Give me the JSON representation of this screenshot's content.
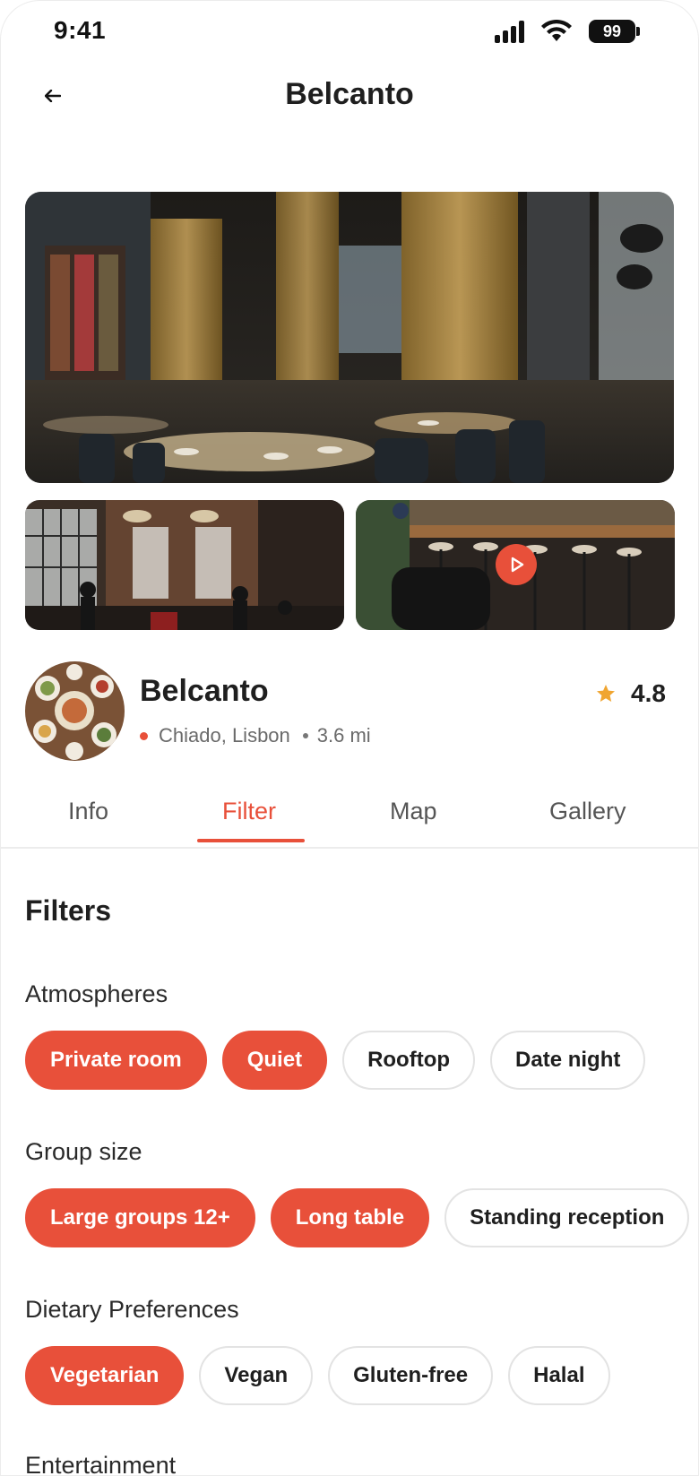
{
  "status_bar": {
    "time": "9:41",
    "battery": "99"
  },
  "header": {
    "title": "Belcanto"
  },
  "gallery": {
    "hero_alt": "restaurant-interior-photo",
    "thumb1_alt": "brick-dining-room-photo",
    "thumb2_alt": "bar-stools-video"
  },
  "venue": {
    "name": "Belcanto",
    "location": "Chiado, Lisbon",
    "distance": "3.6 mi",
    "rating": "4.8"
  },
  "tabs": [
    {
      "label": "Info",
      "active": false
    },
    {
      "label": "Filter",
      "active": true
    },
    {
      "label": "Map",
      "active": false
    },
    {
      "label": "Gallery",
      "active": false
    }
  ],
  "filters": {
    "title": "Filters",
    "sections": [
      {
        "label": "Atmospheres",
        "chips": [
          {
            "label": "Private room",
            "selected": true
          },
          {
            "label": "Quiet",
            "selected": true
          },
          {
            "label": "Rooftop",
            "selected": false
          },
          {
            "label": "Date night",
            "selected": false
          }
        ]
      },
      {
        "label": "Group size",
        "chips": [
          {
            "label": "Large groups 12+",
            "selected": true
          },
          {
            "label": "Long table",
            "selected": true
          },
          {
            "label": "Standing reception",
            "selected": false
          }
        ]
      },
      {
        "label": "Dietary Preferences",
        "chips": [
          {
            "label": "Vegetarian",
            "selected": true
          },
          {
            "label": "Vegan",
            "selected": false
          },
          {
            "label": "Gluten-free",
            "selected": false
          },
          {
            "label": "Halal",
            "selected": false
          }
        ]
      },
      {
        "label": "Entertainment",
        "chips": []
      }
    ]
  },
  "colors": {
    "accent": "#e8503a",
    "star": "#f0a531",
    "text": "#1f1f1f"
  }
}
